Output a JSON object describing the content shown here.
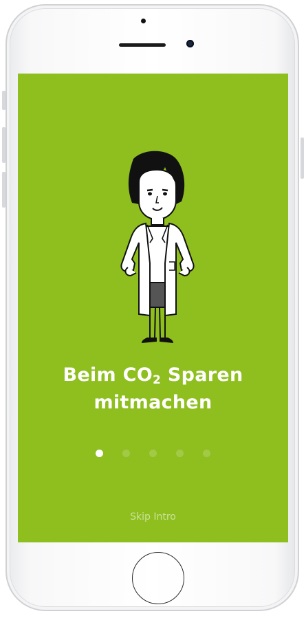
{
  "onboarding": {
    "headline_line1_prefix": "Beim CO",
    "headline_subscript": "2",
    "headline_line1_suffix": " Sparen",
    "headline_line2": "mitmachen",
    "page_indicator": {
      "total": 5,
      "current": 1
    },
    "skip_label": "Skip Intro"
  },
  "colors": {
    "screen_background": "#8ebf1f",
    "text": "#ffffff"
  },
  "illustration": "scientist-in-lab-coat"
}
